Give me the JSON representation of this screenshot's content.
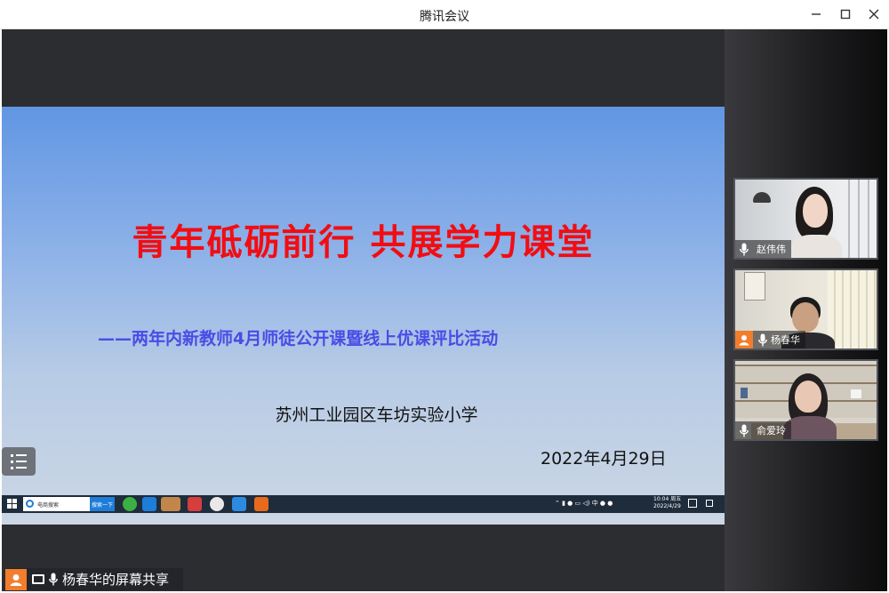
{
  "window": {
    "title": "腾讯会议",
    "controls": [
      "minimize",
      "maximize",
      "close"
    ]
  },
  "slide": {
    "headline": "青年砥砺前行 共展学力课堂",
    "subtitle": "——两年内新教师4月师徒公开课暨线上优课评比活动",
    "school": "苏州工业园区车坊实验小学",
    "date": "2022年4月29日",
    "colors": {
      "headline": "#f20d12",
      "subtitle": "#4b4be6"
    }
  },
  "shared_taskbar": {
    "search_placeholder": "电商搜索",
    "search_button": "搜索一下",
    "tray_ime": "中",
    "clock_time": "10:04 周五",
    "clock_date": "2022/4/29"
  },
  "share_badge": {
    "label": "杨春华的屏幕共享"
  },
  "participants": [
    {
      "name": "赵伟伟",
      "mic": "on",
      "avatar_tag": "mic"
    },
    {
      "name": "杨春华",
      "mic": "on",
      "avatar_tag": "avatar"
    },
    {
      "name": "俞爱玲",
      "mic": "on",
      "avatar_tag": "mic"
    }
  ],
  "icons": {
    "menu": "list-menu-icon",
    "mic": "microphone-icon",
    "avatar": "person-avatar-icon",
    "screen": "screen-share-icon"
  }
}
